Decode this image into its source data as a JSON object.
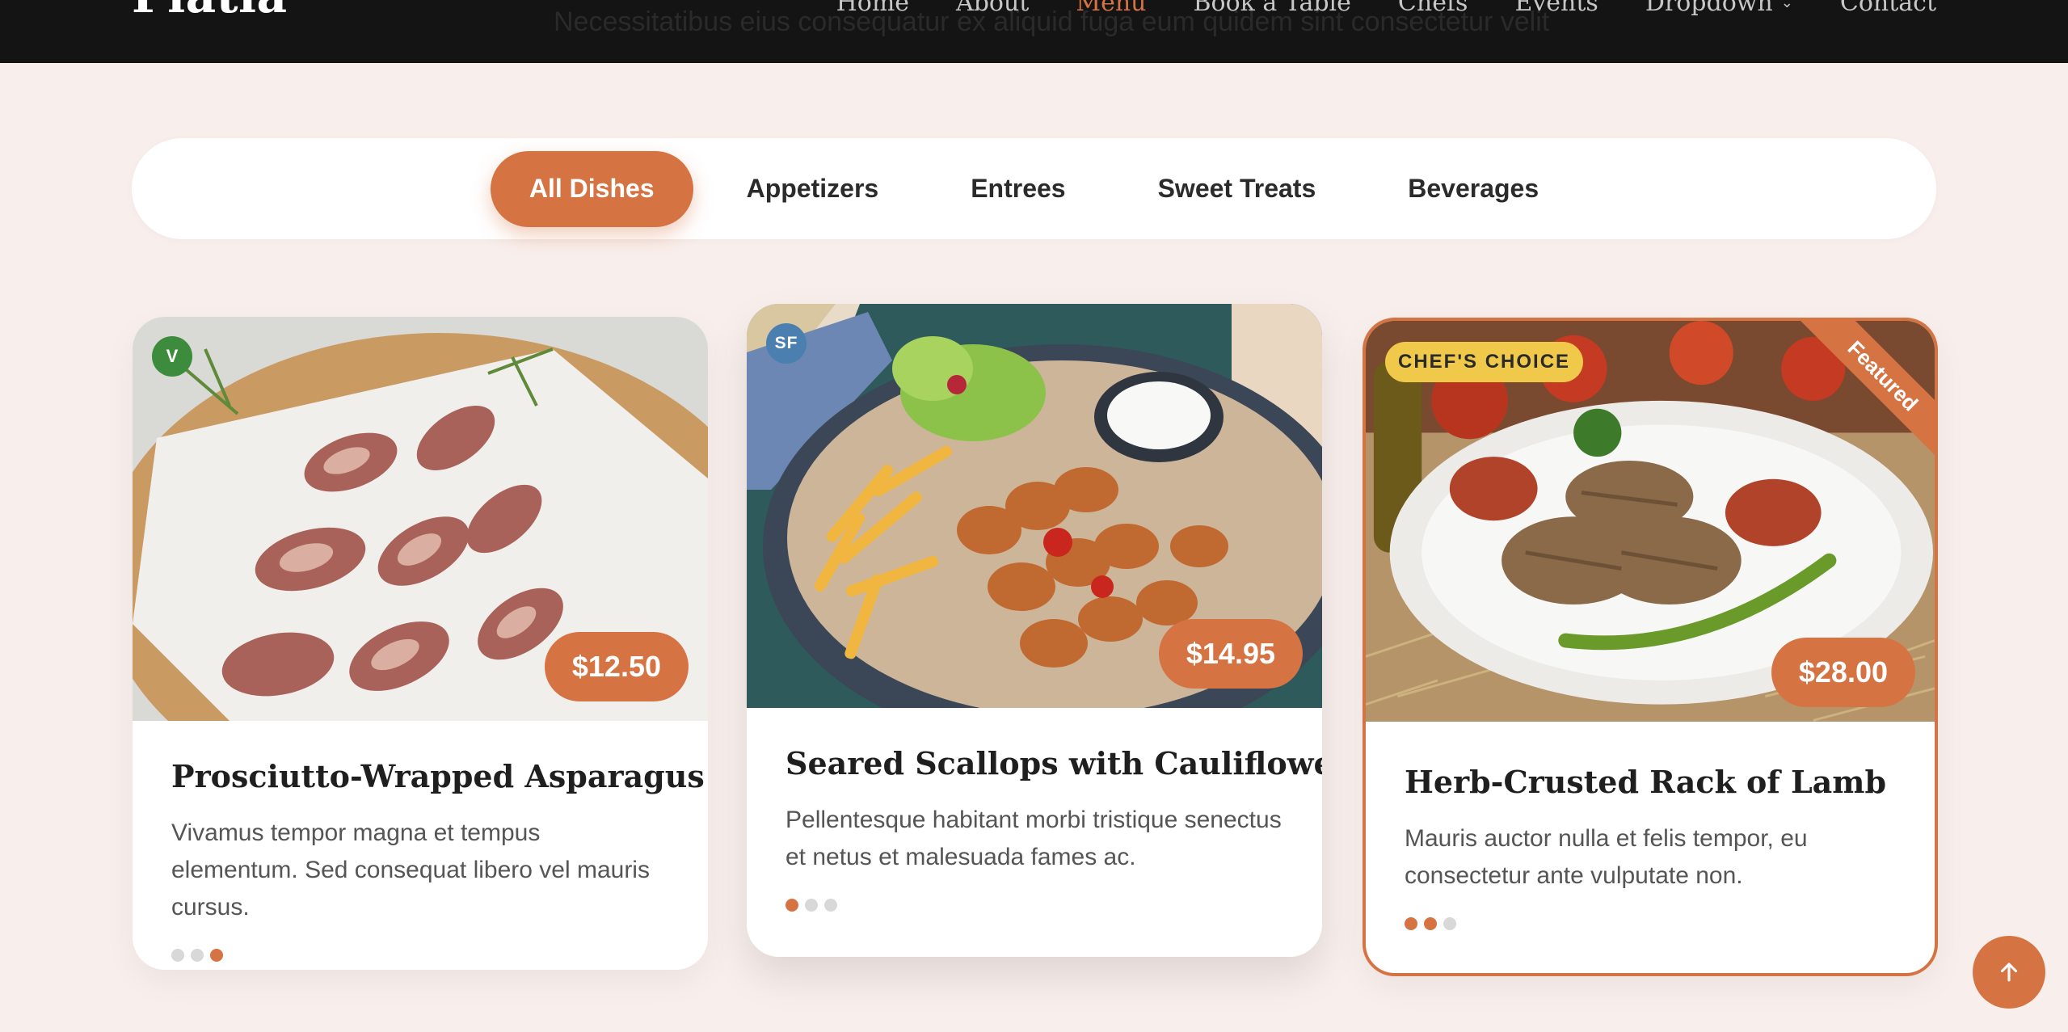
{
  "header": {
    "logo": "Platia",
    "subtitle": "Necessitatibus eius consequatur ex aliquid fuga eum quidem sint consectetur velit",
    "nav": [
      {
        "label": "Home",
        "active": false
      },
      {
        "label": "About",
        "active": false
      },
      {
        "label": "Menu",
        "active": true
      },
      {
        "label": "Book a Table",
        "active": false
      },
      {
        "label": "Chefs",
        "active": false
      },
      {
        "label": "Events",
        "active": false
      },
      {
        "label": "Dropdown",
        "active": false,
        "has_chevron": true
      },
      {
        "label": "Contact",
        "active": false
      }
    ]
  },
  "filters": [
    {
      "label": "All Dishes",
      "active": true
    },
    {
      "label": "Appetizers",
      "active": false
    },
    {
      "label": "Entrees",
      "active": false
    },
    {
      "label": "Sweet Treats",
      "active": false
    },
    {
      "label": "Beverages",
      "active": false
    }
  ],
  "cards": [
    {
      "badge": "V",
      "price": "$12.50",
      "title": "Prosciutto-Wrapped Asparagus",
      "description": "Vivamus tempor magna et tempus elementum. Sed consequat libero vel mauris cursus.",
      "active_dot": 3,
      "dot_count": 3
    },
    {
      "badge": "SF",
      "price": "$14.95",
      "title": "Seared Scallops with Cauliflower",
      "description": "Pellentesque habitant morbi tristique senectus et netus et malesuada fames ac.",
      "active_dot": 1,
      "dot_count": 3
    },
    {
      "chef_badge": "CHEF'S CHOICE",
      "ribbon": "Featured",
      "price": "$28.00",
      "title": "Herb-Crusted Rack of Lamb",
      "description": "Mauris auctor nulla et felis tempor, eu consectetur ante vulputate non.",
      "active_dots": [
        1,
        2
      ],
      "dot_count": 3
    }
  ],
  "colors": {
    "accent": "#d67343",
    "header_bg": "#141414",
    "page_bg": "#f8eeeb",
    "veg_badge": "#3d8b3d",
    "seafood_badge": "#4a7fb0",
    "chef_badge": "#f0c94a"
  },
  "icons": {
    "scroll_top": "arrow-up-icon",
    "dropdown": "chevron-down-icon"
  }
}
